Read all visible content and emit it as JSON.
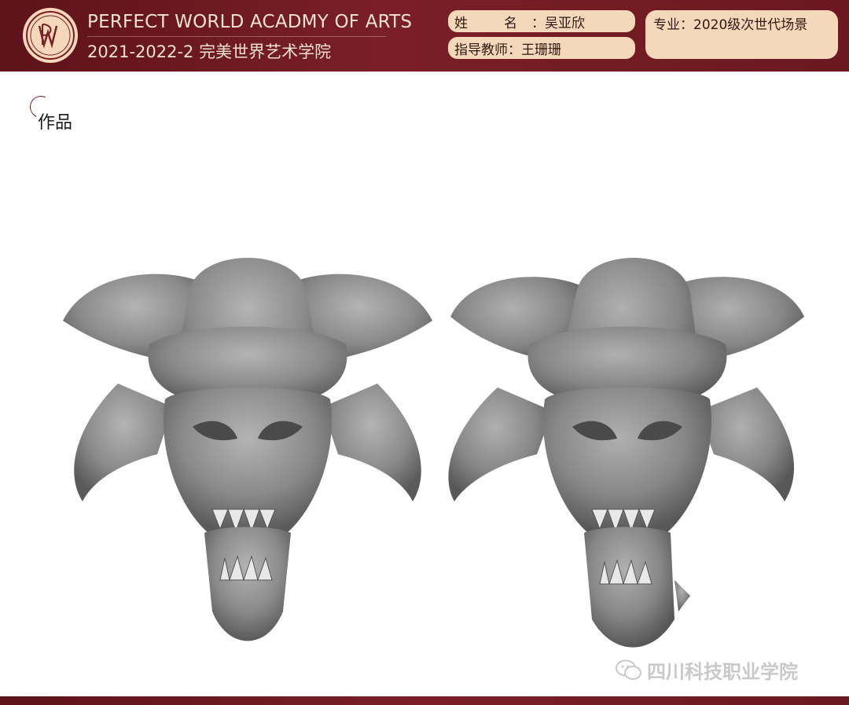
{
  "header": {
    "academy_title": "PERFECT WORLD ACADMY OF ARTS",
    "semester": "2021-2022-2   完美世界艺术学院",
    "logo_letters": "PW",
    "name_label": "姓名",
    "name_sep": "：",
    "name_value": "吴亚欣",
    "teacher_label": "指导教师：",
    "teacher_value": "王珊珊",
    "major_label": "专业：",
    "major_value": "2020级次世代场景"
  },
  "section": {
    "title": "作品"
  },
  "watermark": {
    "text": "四川科技职业学院",
    "icon": "wechat-icon"
  },
  "colors": {
    "header_bg": "#6e1a22",
    "header_text": "#f3e3cf",
    "pill_bg": "#f5d7b9",
    "sculpt_clay": "#8a8a8a"
  },
  "renders": [
    {
      "label": "",
      "view": "front-left"
    },
    {
      "label": "",
      "view": "front-right"
    }
  ]
}
